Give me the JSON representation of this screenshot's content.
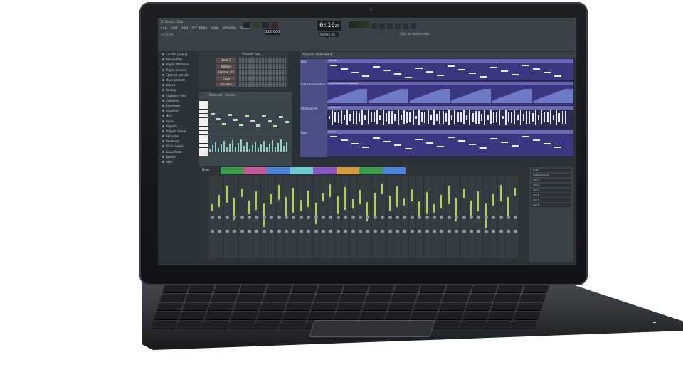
{
  "app": {
    "title": "FL Studio 12.4p",
    "menu": [
      "FILE",
      "EDIT",
      "ADD",
      "PATTERNS",
      "VIEW",
      "OPTIONS",
      "TOOLS",
      "?"
    ],
    "hint": "14:02:04",
    "time": "6:16",
    "time_sub": "20",
    "tempo": "115.000",
    "pattern": "Pattern 20",
    "news": "Click for online news"
  },
  "browser": {
    "items": [
      "Current project",
      "Recent files",
      "Plugin database",
      "Plugin presets",
      "Channel presets",
      "Mixer presets",
      "Scores",
      "Backup",
      "Clipboard files",
      "Collected",
      "Envelopes",
      "Impulses",
      "Misc",
      "Packs",
      "Projects",
      "Projects bones",
      "Recorded",
      "Rendered",
      "Sliced beats",
      "Soundfonts",
      "Speech",
      "User"
    ]
  },
  "channel_rack": {
    "title": "Channel rack",
    "channels": [
      "Beat 1",
      "Harmor",
      "Harmor #2",
      "Cave FX_delay",
      "Plucked"
    ]
  },
  "piano_roll": {
    "title": "Piano roll - Harmor"
  },
  "playlist": {
    "title": "Playlist - Underworld",
    "tracks": [
      {
        "label": "Bass",
        "clip": "Bass #2"
      },
      {
        "label": "Cello Automation",
        "clip": "Cello Automation envelope"
      },
      {
        "label": "Underworld",
        "clip": "Underworld"
      },
      {
        "label": "Bass",
        "clip": "Bass #3"
      }
    ]
  },
  "mixer": {
    "title": "Mixer"
  },
  "fx": {
    "slots": [
      "Fruity",
      "Underworld EQ",
      "Slot 3",
      "Slot 4",
      "Slot 5",
      "Slot 6",
      "Slot 7",
      "Slot 8"
    ]
  },
  "colors": {
    "accent": "#b7d33a",
    "playlist_bg": "#2b2a48",
    "clip": "#6c68b8"
  }
}
